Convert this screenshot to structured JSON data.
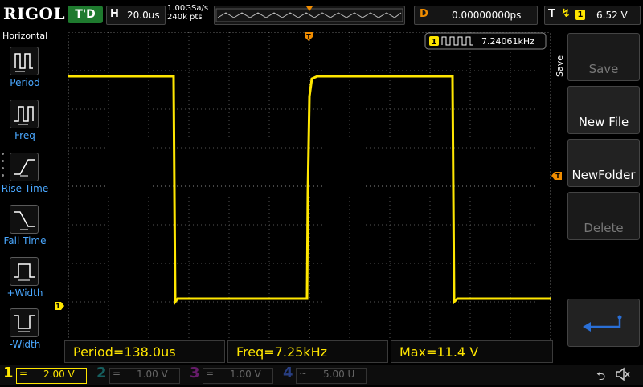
{
  "brand": "RIGOL",
  "status": "T'D",
  "timebase": {
    "key": "H",
    "value": "20.0us"
  },
  "sample": {
    "rate": "1.00GSa/s",
    "points": "240k pts"
  },
  "delay": {
    "key": "D",
    "value": "0.00000000ps"
  },
  "trigger": {
    "key": "T",
    "source": "1",
    "level": "6.52 V"
  },
  "left_menu": {
    "title": "Horizontal",
    "items": [
      {
        "label": "Period",
        "icon": "period-icon"
      },
      {
        "label": "Freq",
        "icon": "freq-icon"
      },
      {
        "label": "Rise Time",
        "icon": "rise-time-icon"
      },
      {
        "label": "Fall Time",
        "icon": "fall-time-icon"
      },
      {
        "label": "+Width",
        "icon": "positive-width-icon"
      },
      {
        "label": "-Width",
        "icon": "negative-width-icon"
      }
    ]
  },
  "freq_counter": {
    "channel": "1",
    "value": "7.24061kHz"
  },
  "measurements": [
    {
      "text": "Period=138.0us"
    },
    {
      "text": "Freq=7.25kHz"
    },
    {
      "text": "Max=11.4 V"
    }
  ],
  "right_menu": {
    "title": "Save",
    "buttons": [
      {
        "label": "Save",
        "enabled": false
      },
      {
        "label": "New File",
        "enabled": true
      },
      {
        "label": "NewFolder",
        "enabled": true
      },
      {
        "label": "Delete",
        "enabled": false
      }
    ]
  },
  "channels": [
    {
      "num": "1",
      "coupling": "=",
      "scale": "2.00 V",
      "color": "#ffe600",
      "active": true
    },
    {
      "num": "2",
      "coupling": "=",
      "scale": "1.00 V",
      "color": "#1fb0b0",
      "active": false
    },
    {
      "num": "3",
      "coupling": "=",
      "scale": "1.00 V",
      "color": "#c02cc8",
      "active": false
    },
    {
      "num": "4",
      "coupling": "~",
      "scale": "5.00 U",
      "color": "#3a5fd0",
      "active": false
    }
  ],
  "colors": {
    "ch1": "#ffe600",
    "accent": "#f08c00",
    "menu_label": "#4aa8ff",
    "button_blue": "#2a6fd6"
  }
}
